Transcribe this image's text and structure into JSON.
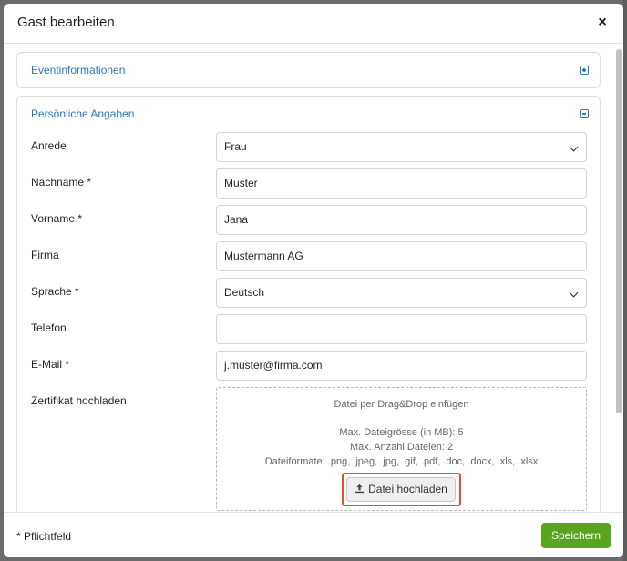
{
  "modal": {
    "title": "Gast bearbeiten",
    "close_icon": "close-icon",
    "close_glyph": "×"
  },
  "sections": [
    {
      "title": "Eventinformationen",
      "state": "collapsed",
      "icon": "plus-square-icon"
    },
    {
      "title": "Persönliche Angaben",
      "state": "expanded",
      "icon": "minus-square-icon"
    }
  ],
  "form": {
    "anrede": {
      "label": "Anrede",
      "value": "Frau"
    },
    "nachname": {
      "label": "Nachname *",
      "value": "Muster"
    },
    "vorname": {
      "label": "Vorname *",
      "value": "Jana"
    },
    "firma": {
      "label": "Firma",
      "value": "Mustermann AG"
    },
    "sprache": {
      "label": "Sprache *",
      "value": "Deutsch"
    },
    "telefon": {
      "label": "Telefon",
      "value": ""
    },
    "email": {
      "label": "E-Mail *",
      "value": "j.muster@firma.com"
    },
    "zertifikat": {
      "label": "Zertifikat hochladen",
      "drop_hint": "Datei per Drag&Drop einfügen",
      "max_size": "Max. Dateigrösse (in MB): 5",
      "max_files": "Max. Anzahl Dateien: 2",
      "formats": "Dateiformate: .png, .jpeg, .jpg, .gif, .pdf, .doc, .docx, .xls, .xlsx",
      "upload_button": "Datei hochladen",
      "upload_icon": "upload-icon"
    }
  },
  "footer": {
    "required_note": "* Pflichtfeld",
    "save_button": "Speichern"
  },
  "colors": {
    "accent": "#2a78b4",
    "save": "#5aa520",
    "highlight": "#e3502b"
  }
}
